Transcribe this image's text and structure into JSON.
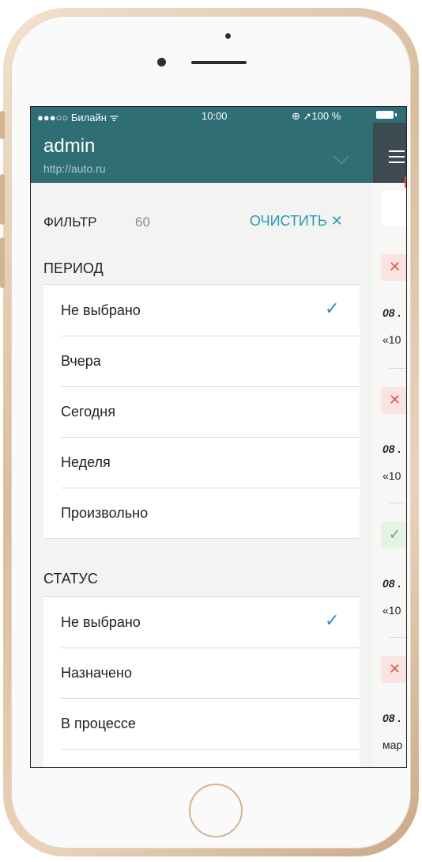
{
  "status_bar": {
    "carrier": "●●●○○ Билайн ᯤ",
    "time": "10:00",
    "battery": "⊕ ➚100 %"
  },
  "header": {
    "title": "admin",
    "url": "http://auto.ru"
  },
  "filter": {
    "label": "ФИЛЬТР",
    "count": "60",
    "clear_label": "ОЧИСТИТЬ ✕"
  },
  "period": {
    "title": "ПЕРИОД",
    "options": [
      {
        "label": "Не выбрано",
        "selected": true
      },
      {
        "label": "Вчера",
        "selected": false
      },
      {
        "label": "Сегодня",
        "selected": false
      },
      {
        "label": "Неделя",
        "selected": false
      },
      {
        "label": "Произвольно",
        "selected": false
      }
    ]
  },
  "status": {
    "title": "СТАТУС",
    "options": [
      {
        "label": "Не выбрано",
        "selected": true
      },
      {
        "label": "Назначено",
        "selected": false
      },
      {
        "label": "В процессе",
        "selected": false
      }
    ]
  },
  "check_glyph": "✓",
  "background_list": {
    "items": [
      {
        "icon": "✕",
        "date": "08 .",
        "text": "«10"
      },
      {
        "icon": "✕",
        "date": "08 .",
        "text": "«10"
      },
      {
        "icon": "✓",
        "date": "08 .",
        "text": "«10"
      },
      {
        "icon": "✕",
        "date": "08 .",
        "text": "мар"
      }
    ]
  },
  "colors": {
    "header": "#2f6e74",
    "accent": "#2a9ab3",
    "check": "#2a8dcc",
    "phone_gold": "#d9bd9e"
  }
}
